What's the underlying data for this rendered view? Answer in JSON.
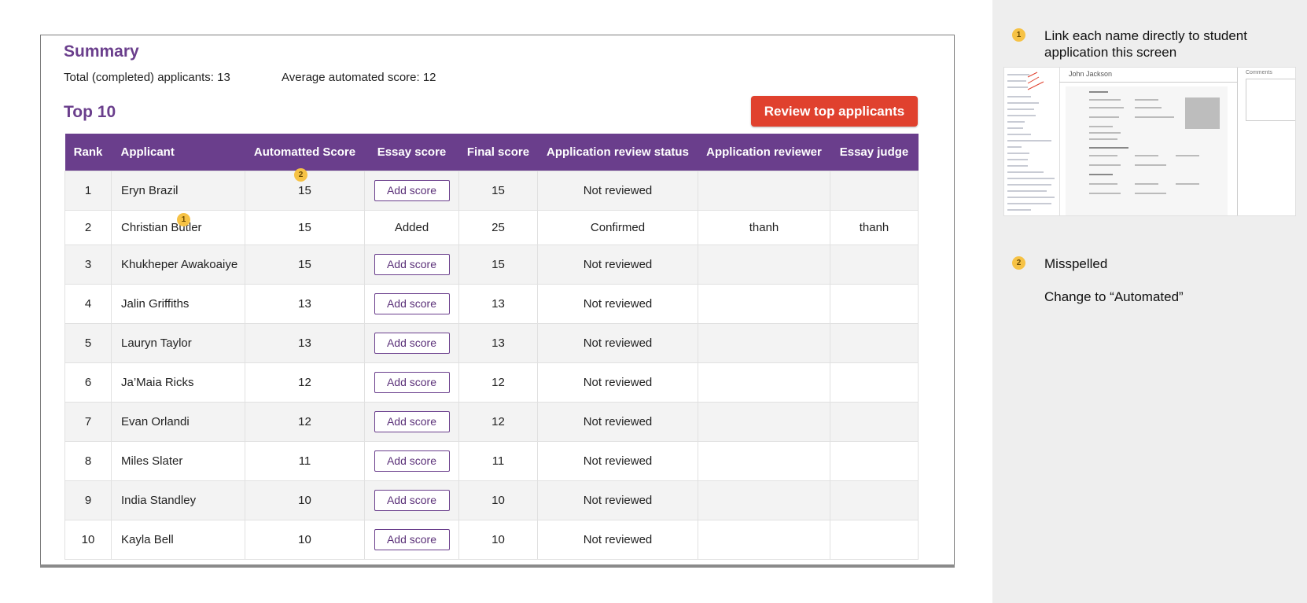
{
  "summary": {
    "title": "Summary",
    "total_applicants": "Total (completed) applicants: 13",
    "average_score": "Average automated score: 12"
  },
  "top": {
    "title": "Top 10",
    "review_button": "Review top applicants"
  },
  "table": {
    "headers": [
      "Rank",
      "Applicant",
      "Automatted Score",
      "Essay score",
      "Final score",
      "Application review status",
      "Application reviewer",
      "Essay judge"
    ],
    "rows": [
      {
        "rank": "1",
        "applicant": "Eryn Brazil",
        "auto": "15",
        "essay": "Add score",
        "final": "15",
        "status": "Not reviewed",
        "reviewer": "",
        "judge": ""
      },
      {
        "rank": "2",
        "applicant": "Christian Butler",
        "auto": "15",
        "essay": "Added",
        "final": "25",
        "status": "Confirmed",
        "reviewer": "thanh",
        "judge": "thanh"
      },
      {
        "rank": "3",
        "applicant": "Khukheper Awakoaiye",
        "auto": "15",
        "essay": "Add score",
        "final": "15",
        "status": "Not reviewed",
        "reviewer": "",
        "judge": ""
      },
      {
        "rank": "4",
        "applicant": "Jalin Griffiths",
        "auto": "13",
        "essay": "Add score",
        "final": "13",
        "status": "Not reviewed",
        "reviewer": "",
        "judge": ""
      },
      {
        "rank": "5",
        "applicant": "Lauryn Taylor",
        "auto": "13",
        "essay": "Add score",
        "final": "13",
        "status": "Not reviewed",
        "reviewer": "",
        "judge": ""
      },
      {
        "rank": "6",
        "applicant": "Ja’Maia Ricks",
        "auto": "12",
        "essay": "Add score",
        "final": "12",
        "status": "Not reviewed",
        "reviewer": "",
        "judge": ""
      },
      {
        "rank": "7",
        "applicant": "Evan Orlandi",
        "auto": "12",
        "essay": "Add score",
        "final": "12",
        "status": "Not reviewed",
        "reviewer": "",
        "judge": ""
      },
      {
        "rank": "8",
        "applicant": "Miles Slater",
        "auto": "11",
        "essay": "Add score",
        "final": "11",
        "status": "Not reviewed",
        "reviewer": "",
        "judge": ""
      },
      {
        "rank": "9",
        "applicant": "India Standley",
        "auto": "10",
        "essay": "Add score",
        "final": "10",
        "status": "Not reviewed",
        "reviewer": "",
        "judge": ""
      },
      {
        "rank": "10",
        "applicant": "Kayla Bell",
        "auto": "10",
        "essay": "Add score",
        "final": "10",
        "status": "Not reviewed",
        "reviewer": "",
        "judge": ""
      }
    ]
  },
  "annotations": {
    "marker_1": "1",
    "marker_2": "2",
    "note_1_line1": "Link each name directly to student",
    "note_1_line2": "application this screen",
    "note_2_title": "Misspelled",
    "note_2_body": "Change to “Automated”",
    "thumbnail": {
      "header_name": "John Jackson",
      "comments_label": "Comments"
    }
  },
  "colors": {
    "accent_purple": "#6a3e8c",
    "review_button": "#e0412e",
    "marker_yellow": "#f6c245",
    "side_panel": "#eeeeee"
  }
}
